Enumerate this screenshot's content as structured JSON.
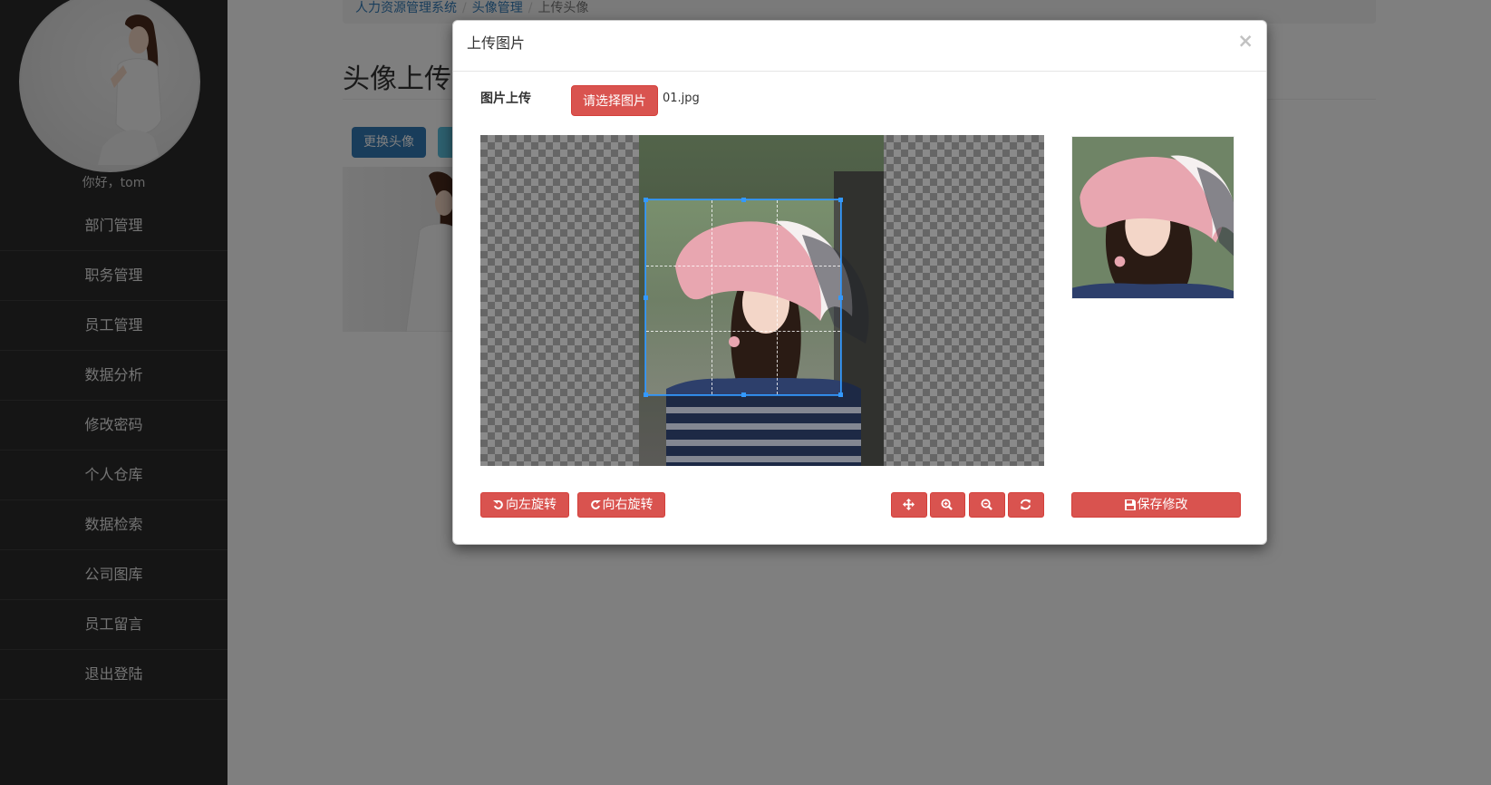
{
  "sidebar": {
    "greeting": "你好，tom",
    "items": [
      {
        "label": "部门管理"
      },
      {
        "label": "职务管理"
      },
      {
        "label": "员工管理"
      },
      {
        "label": "数据分析"
      },
      {
        "label": "修改密码"
      },
      {
        "label": "个人仓库"
      },
      {
        "label": "数据检索"
      },
      {
        "label": "公司图库"
      },
      {
        "label": "员工留言"
      },
      {
        "label": "退出登陆"
      }
    ]
  },
  "breadcrumb": {
    "items": [
      "人力资源管理系统",
      "头像管理",
      "上传头像"
    ]
  },
  "page": {
    "title": "头像上传",
    "change_button": "更换头像"
  },
  "modal": {
    "title": "上传图片",
    "close": "×",
    "upload_label": "图片上传",
    "choose_button": "请选择图片",
    "file_name": "01.jpg",
    "rotate_left": "向左旋转",
    "rotate_right": "向右旋转",
    "save": "保存修改"
  },
  "icons": {
    "rotate_left": "rotate-left-icon",
    "rotate_right": "rotate-right-icon",
    "move": "move-icon",
    "zoom_in": "zoom-in-icon",
    "zoom_out": "zoom-out-icon",
    "refresh": "refresh-icon",
    "save": "floppy-disk-icon",
    "close": "close-icon"
  },
  "colors": {
    "sidebar_bg": "#2b2b2b",
    "primary": "#337ab7",
    "danger": "#d9534f",
    "crop_border": "#3399ff"
  }
}
